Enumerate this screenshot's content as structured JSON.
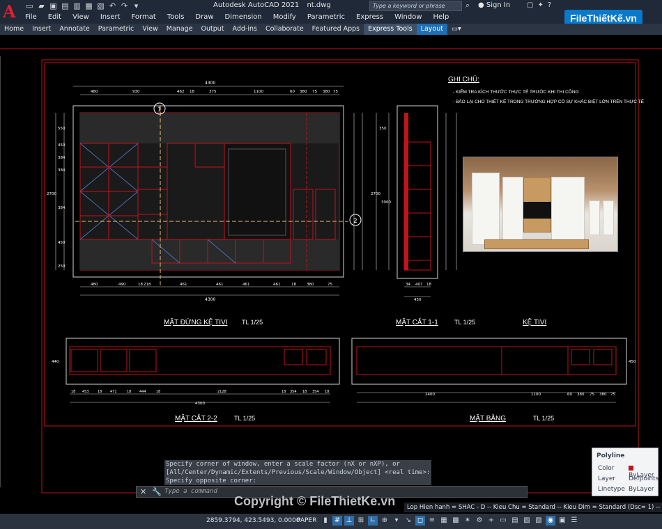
{
  "app": {
    "title": "Autodesk AutoCAD 2021",
    "file": "nt.dwg",
    "logo_letter": "A",
    "search_placeholder": "Type a keyword or phrase",
    "sign_in": "Sign In"
  },
  "menu": [
    "File",
    "Edit",
    "View",
    "Insert",
    "Format",
    "Tools",
    "Draw",
    "Dimension",
    "Modify",
    "Parametric",
    "Express",
    "Window",
    "Help"
  ],
  "ribbon_tabs": [
    {
      "label": "Home"
    },
    {
      "label": "Insert"
    },
    {
      "label": "Annotate"
    },
    {
      "label": "Parametric"
    },
    {
      "label": "View"
    },
    {
      "label": "Manage"
    },
    {
      "label": "Output"
    },
    {
      "label": "Add-ins"
    },
    {
      "label": "Collaborate"
    },
    {
      "label": "Featured Apps"
    },
    {
      "label": "Express Tools"
    },
    {
      "label": "Layout"
    }
  ],
  "watermark": "FileThiếtKế.vn",
  "drawing": {
    "notes_title": "GHI CHÚ:",
    "notes": [
      "- KIỂM TRA KÍCH THƯỚC THỰC TẾ TRƯỚC KHI THI CÔNG",
      "- BÁO LẠI CHO THIẾT KẾ TRONG TRƯỜNG HỢP CÓ SỰ KHÁC BIỆT LỚN TRÊN THỰC TẾ"
    ],
    "labels": {
      "front": "MẶT ĐỨNG KỆ TIVI",
      "front_scale": "TL 1/25",
      "section11": "MẶT CẮT 1-1",
      "section11_scale": "TL 1/25",
      "ke_tivi": "KỆ TIVI",
      "section22": "MẶT CẮT 2-2",
      "section22_scale": "TL 1/25",
      "plan": "MẶT BẰNG",
      "plan_scale": "TL 1/25"
    },
    "markers": {
      "m1": "1",
      "m2": "2"
    },
    "dims_top": [
      "480",
      "930",
      "462",
      "18",
      "375",
      "1100",
      "60",
      "380",
      "75",
      "380",
      "75"
    ],
    "dim_total": "4300",
    "dims_bottom": [
      "480",
      "490",
      "18",
      "218",
      "461",
      "461",
      "461",
      "461",
      "18",
      "380",
      "75"
    ],
    "dims_left": [
      "550",
      "450",
      "384",
      "384",
      "2700",
      "384",
      "450",
      "250"
    ],
    "sec11_dims": [
      "34",
      "407",
      "18"
    ],
    "sec11_total": "450",
    "sec11_heights": [
      "350",
      "2700",
      "3000"
    ],
    "sec22_dims": [
      "18",
      "453",
      "18",
      "471",
      "18",
      "444",
      "18",
      "2128",
      "18",
      "354",
      "18",
      "354",
      "18"
    ],
    "sec22_total": "4300",
    "sec22_height": "440",
    "plan_dims": [
      "2400",
      "1100",
      "60",
      "380",
      "75",
      "380",
      "75"
    ],
    "plan_height": "450"
  },
  "command": {
    "line1": "Specify corner of window, enter a scale factor (nX or nXP), or",
    "line2": "[All/Center/Dynamic/Extents/Previous/Scale/Window/Object] <real time>:",
    "line3": "Specify opposite corner:",
    "prompt": "Type a command"
  },
  "properties": {
    "header": "Polyline",
    "rows": [
      {
        "key": "Color",
        "value": "ByLayer"
      },
      {
        "key": "Layer",
        "value": "Defpoints"
      },
      {
        "key": "Linetype",
        "value": "ByLayer"
      }
    ]
  },
  "layer_info": "Lop Hien hanh = SHAC - D -- Kieu Chu = Standard -- Kieu Dim = Standard (Dsc= 1) -- K...",
  "status": {
    "coords": "2859.3794, 423.5493, 0.0000",
    "space": "PAPER"
  },
  "copyright": "Copyright © FileThietKe.vn",
  "colors": {
    "accent": "#1e6fb5",
    "red_line": "#c1121f",
    "dim_line": "#d6d3d1"
  }
}
